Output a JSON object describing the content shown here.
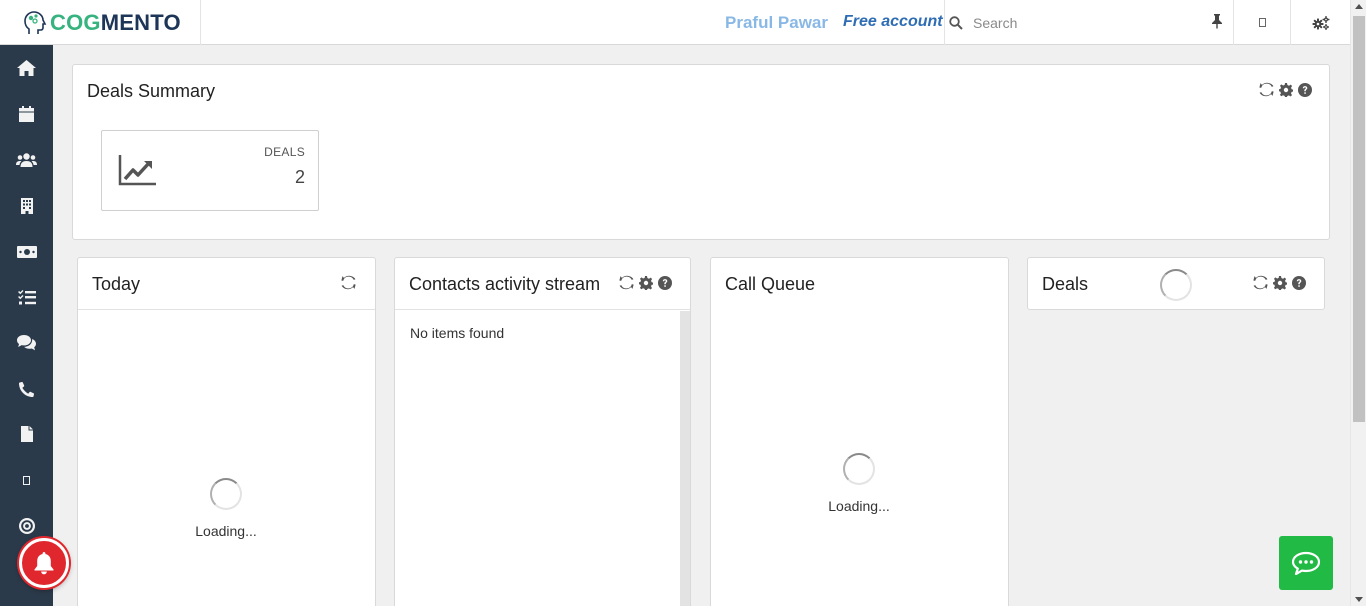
{
  "header": {
    "logo_cog": "COG",
    "logo_mento": "MENTO",
    "user_name": "Praful Pawar",
    "account_type": "Free account",
    "search_placeholder": "Search"
  },
  "sidebar": {
    "items": [
      {
        "icon": "home-icon"
      },
      {
        "icon": "calendar-icon"
      },
      {
        "icon": "contacts-icon"
      },
      {
        "icon": "companies-icon"
      },
      {
        "icon": "deals-money-icon"
      },
      {
        "icon": "tasks-icon"
      },
      {
        "icon": "cases-comments-icon"
      },
      {
        "icon": "calls-phone-icon"
      },
      {
        "icon": "documents-icon"
      },
      {
        "icon": "email-icon"
      },
      {
        "icon": "campaigns-target-icon"
      }
    ]
  },
  "deals_summary": {
    "title": "Deals Summary",
    "stat_label": "DEALS",
    "stat_value": "2"
  },
  "widgets": {
    "today": {
      "title": "Today",
      "loading": "Loading..."
    },
    "contacts": {
      "title": "Contacts activity stream",
      "empty": "No items found"
    },
    "call_queue": {
      "title": "Call Queue",
      "loading": "Loading..."
    },
    "deals": {
      "title": "Deals"
    }
  },
  "colors": {
    "sidebar_bg": "#2b3a4a",
    "logo_green": "#36b37e",
    "logo_navy": "#1d3557",
    "user_name": "#8ab8e6",
    "account_type": "#2e6db4",
    "bell": "#e0272e",
    "chat_button": "#21ba45"
  }
}
